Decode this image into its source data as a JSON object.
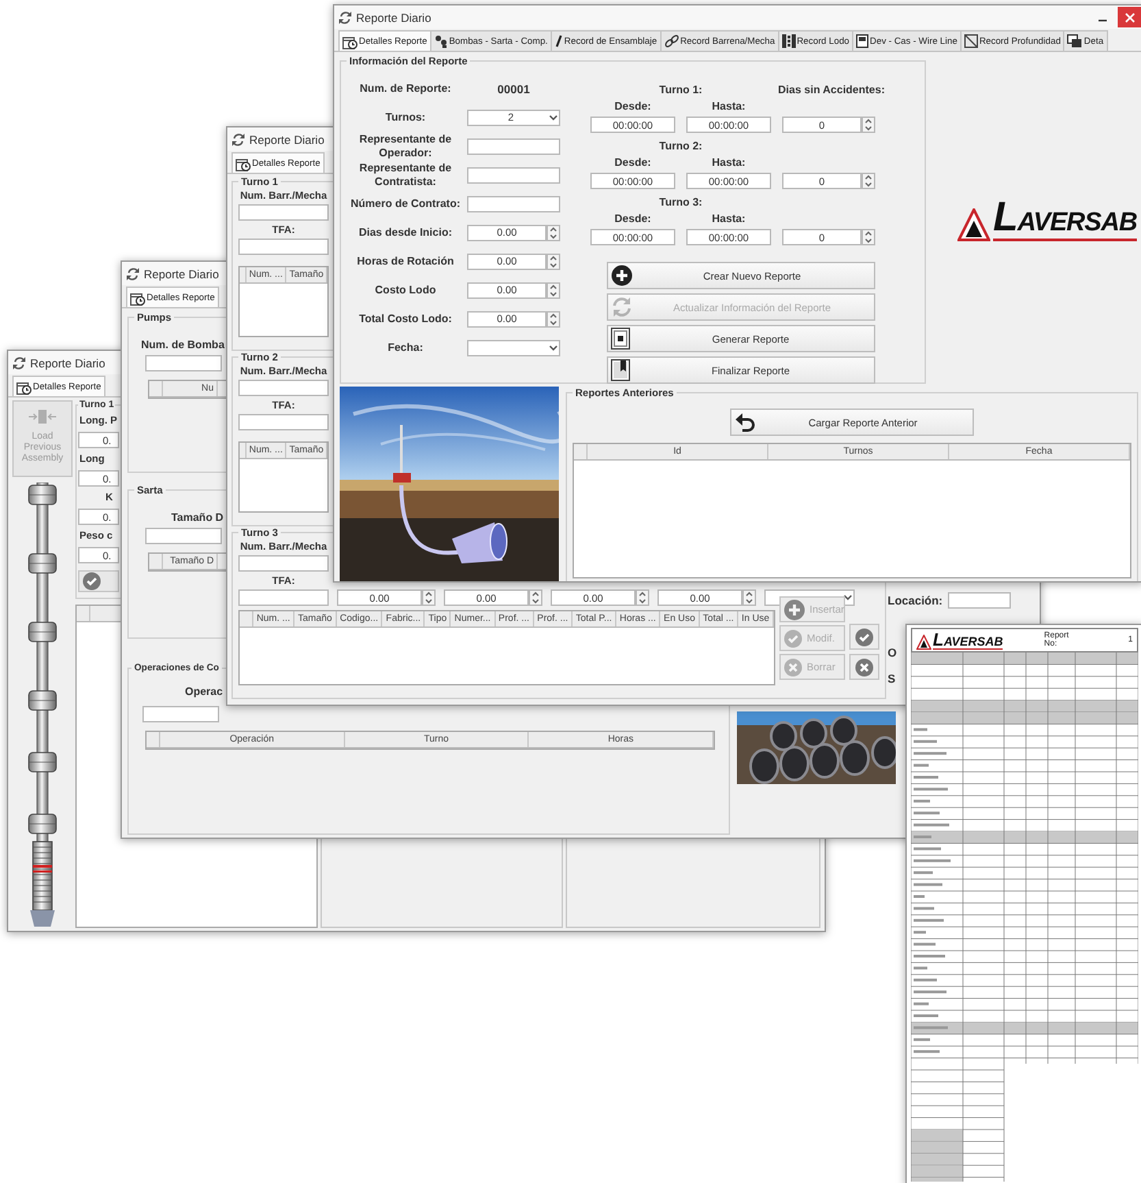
{
  "windows": [
    {
      "kind": "assembly",
      "title": "Reporte Diario",
      "tabs": [
        {
          "label": "Detalles Reporte",
          "selected": true,
          "kind": "calendar"
        }
      ],
      "load_button": {
        "label": "Load Previous Assembly",
        "disabled": true
      },
      "group": "Turno 1",
      "fields": [
        {
          "label": "Long. P",
          "value": "0."
        },
        {
          "label": "Long",
          "value": "0."
        },
        {
          "label": "K",
          "value": "0."
        },
        {
          "label": "Peso c",
          "value": "0."
        }
      ]
    },
    {
      "kind": "pumps",
      "title": "Reporte Diario",
      "tabs": [
        {
          "label": "Detalles Reporte",
          "selected": true,
          "kind": "calendar"
        }
      ],
      "groups": [
        {
          "title": "Pumps",
          "label": "Num. de Bomba",
          "columns": [
            "Nu"
          ]
        },
        {
          "title": "Sarta",
          "label": "Tamaño D",
          "columns": [
            "Tamaño D"
          ]
        },
        {
          "title": "Operaciones de Co",
          "label": "Operac",
          "columns": [
            "Operación",
            "Turno",
            "Horas"
          ]
        }
      ]
    },
    {
      "kind": "turnos",
      "title": "Reporte Diario",
      "tabs": [
        {
          "label": "Detalles Reporte",
          "selected": true,
          "kind": "calendar"
        }
      ],
      "shifts": [
        {
          "title": "Turno 1",
          "bit_label": "Num. Barr./Mecha",
          "tfa_label": "TFA:",
          "columns": [
            "Num. ...",
            "Tamaño"
          ]
        },
        {
          "title": "Turno 2",
          "bit_label": "Num. Barr./Mecha",
          "tfa_label": "TFA:",
          "columns": [
            "Num. ...",
            "Tamaño"
          ]
        },
        {
          "title": "Turno 3",
          "bit_label": "Num. Barr./Mecha",
          "tfa_label": "TFA:",
          "inputs": [
            {
              "kind": "text"
            },
            {
              "kind": "spin",
              "value": "0.00"
            },
            {
              "kind": "spin",
              "value": "0.00"
            },
            {
              "kind": "spin",
              "value": "0.00"
            },
            {
              "kind": "spin",
              "value": "0.00"
            },
            {
              "kind": "combo"
            }
          ],
          "columns": [
            "Num. ...",
            "Tamaño",
            "Codigo...",
            "Fabric...",
            "Tipo",
            "Numer...",
            "Prof. ...",
            "Prof. ...",
            "Total P...",
            "Horas ...",
            "En Uso",
            "Total ...",
            "In Use"
          ],
          "actions": [
            {
              "label": "Insertar",
              "kind": "add",
              "disabled": true
            },
            {
              "label": "Modif.",
              "kind": "check",
              "disabled": true
            },
            {
              "label": "Borrar",
              "kind": "delete",
              "disabled": true
            }
          ],
          "icon_actions": [
            {
              "kind": "check"
            },
            {
              "kind": "delete"
            }
          ]
        }
      ],
      "right_fields": [
        {
          "label": "Locación:",
          "kind": "text"
        },
        {
          "label": "O"
        },
        {
          "label": "S"
        }
      ]
    },
    {
      "kind": "main",
      "title": "Reporte Diario",
      "controls": true,
      "tabs": [
        {
          "label": "Detalles Reporte",
          "selected": true,
          "kind": "calendar"
        },
        {
          "label": "Bombas - Sarta - Comp.",
          "selected": false,
          "kind": "pump"
        },
        {
          "label": "Record de Ensamblaje",
          "selected": false,
          "kind": "slash"
        },
        {
          "label": "Record Barrena/Mecha",
          "selected": false,
          "kind": "link"
        },
        {
          "label": "Record Lodo",
          "selected": false,
          "kind": "grid"
        },
        {
          "label": "Dev - Cas - Wire Line",
          "selected": false,
          "kind": "document"
        },
        {
          "label": "Record Profundidad",
          "selected": false,
          "kind": "ruler"
        },
        {
          "label": "Deta",
          "selected": false,
          "kind": "window"
        }
      ],
      "info": {
        "title": "Información del Reporte",
        "fields": [
          {
            "label": "Num. de Reporte:",
            "kind": "value",
            "value": "00001"
          },
          {
            "label": "Turnos:",
            "kind": "combo",
            "value": "2"
          },
          {
            "label": "Representante de Operador:",
            "kind": "text"
          },
          {
            "label": "Representante de Contratista:",
            "kind": "text"
          },
          {
            "label": "Número de Contrato:",
            "kind": "text"
          },
          {
            "label": "Dias desde Inicio:",
            "kind": "spin",
            "value": "0.00"
          },
          {
            "label": "Horas de Rotación",
            "kind": "spin",
            "value": "0.00"
          },
          {
            "label": "Costo Lodo",
            "kind": "spin",
            "value": "0.00"
          },
          {
            "label": "Total Costo Lodo:",
            "kind": "spin",
            "value": "0.00"
          },
          {
            "label": "Fecha:",
            "kind": "combo"
          }
        ],
        "days_label": "Dias sin Accidentes:",
        "shifts": [
          {
            "title": "Turno 1:",
            "from_label": "Desde:",
            "to_label": "Hasta:",
            "from": "00:00:00",
            "to": "00:00:00",
            "days": "0"
          },
          {
            "title": "Turno 2:",
            "from_label": "Desde:",
            "to_label": "Hasta:",
            "from": "00:00:00",
            "to": "00:00:00",
            "days": "0"
          },
          {
            "title": "Turno 3:",
            "from_label": "Desde:",
            "to_label": "Hasta:",
            "from": "00:00:00",
            "to": "00:00:00",
            "days": "0"
          }
        ],
        "buttons": [
          {
            "label": "Crear Nuevo Reporte",
            "kind": "add",
            "disabled": false
          },
          {
            "label": "Actualizar Información del Reporte",
            "kind": "refresh",
            "disabled": true
          },
          {
            "label": "Generar Reporte",
            "kind": "generate",
            "disabled": false
          },
          {
            "label": "Finalizar Reporte",
            "kind": "finalize",
            "disabled": false
          }
        ]
      },
      "logo": "LAVERSAB",
      "previous": {
        "title": "Reportes Anteriores",
        "button": "Cargar Reporte Anterior",
        "columns": [
          "Id",
          "Turnos",
          "Fecha"
        ]
      }
    }
  ],
  "report_doc": {
    "logo": "LAVERSAB",
    "number_label": "Report No:",
    "number": "1"
  }
}
